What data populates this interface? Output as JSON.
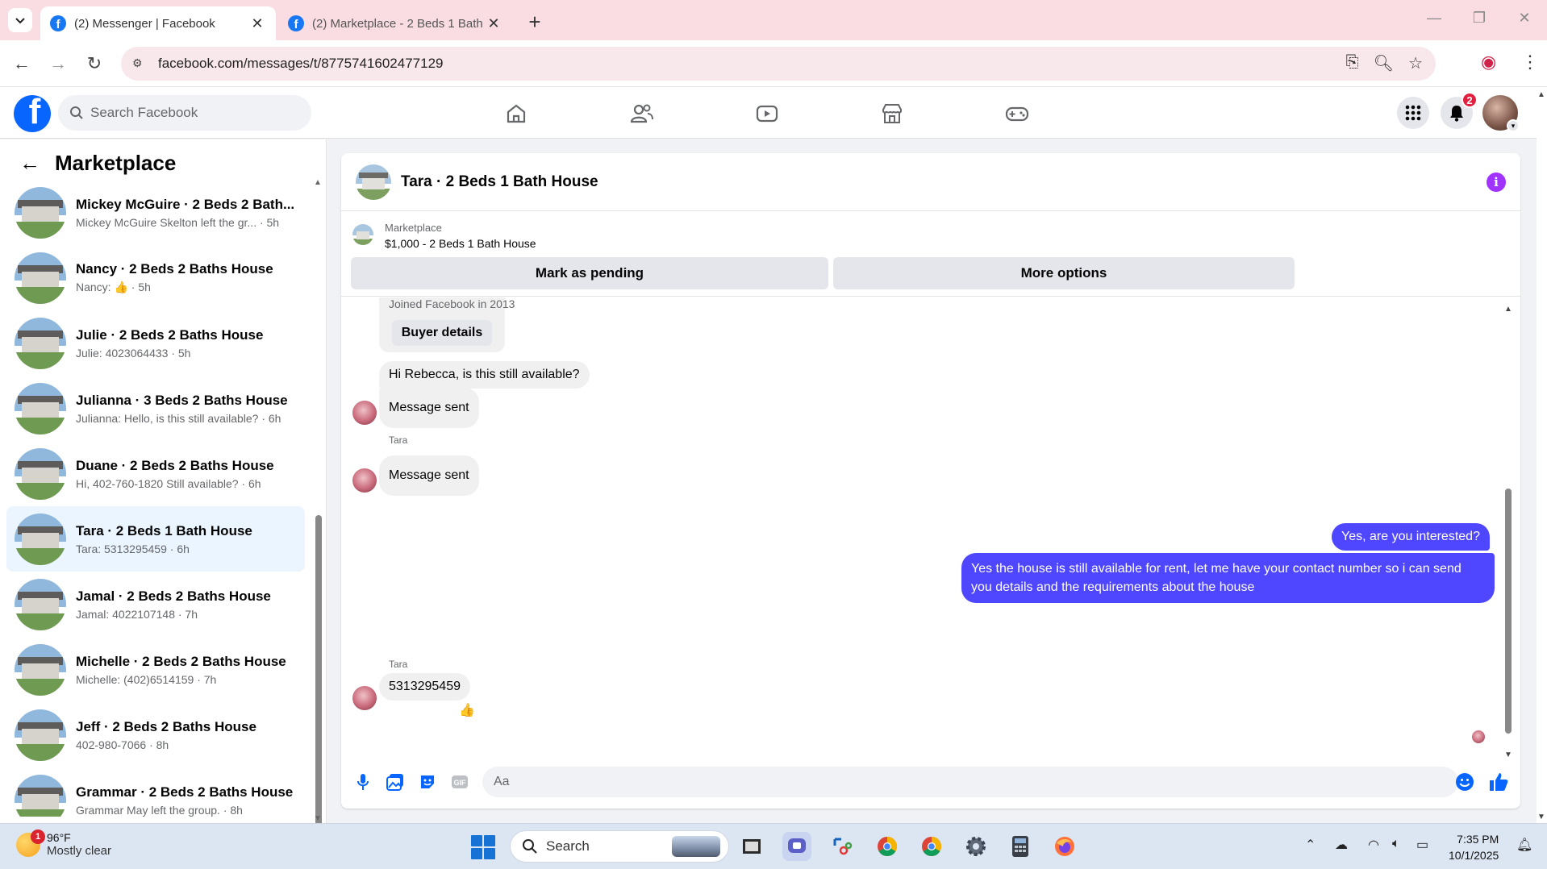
{
  "browser": {
    "tabs": [
      {
        "title": "(2) Messenger | Facebook",
        "active": true
      },
      {
        "title": "(2) Marketplace - 2 Beds 1 Bath",
        "active": false
      }
    ],
    "url": "facebook.com/messages/t/8775741602477129"
  },
  "header": {
    "search_placeholder": "Search Facebook",
    "notifications_count": "2",
    "icons": [
      "home-icon",
      "friends-icon",
      "video-icon",
      "marketplace-icon",
      "gaming-icon",
      "menu-grid-icon",
      "bell-icon"
    ]
  },
  "sidebar": {
    "title": "Marketplace",
    "conversations": [
      {
        "name": "Mickey McGuire · 2 Beds 2 Bath...",
        "preview": "Mickey McGuire Skelton left the gr... · 5h"
      },
      {
        "name": "Nancy · 2 Beds 2 Baths House",
        "preview": "Nancy: 👍 · 5h"
      },
      {
        "name": "Julie · 2 Beds 2 Baths House",
        "preview": "Julie: 4023064433 · 5h"
      },
      {
        "name": "Julianna · 3 Beds 2 Baths House",
        "preview": "Julianna: Hello, is this still available? · 6h"
      },
      {
        "name": "Duane · 2 Beds 2 Baths House",
        "preview": "Hi, 402-760-1820 Still available? · 6h"
      },
      {
        "name": "Tara · 2 Beds 1 Bath House",
        "preview": "Tara: 5313295459 · 6h",
        "selected": true
      },
      {
        "name": "Jamal · 2 Beds 2 Baths House",
        "preview": "Jamal: 4022107148 · 7h"
      },
      {
        "name": "Michelle · 2 Beds 2 Baths House",
        "preview": "Michelle: (402)6514159 · 7h"
      },
      {
        "name": "Jeff · 2 Beds 2 Baths House",
        "preview": "402-980-7066 · 8h"
      },
      {
        "name": "Grammar · 2 Beds 2 Baths House",
        "preview": "Grammar May left the group. · 8h"
      }
    ]
  },
  "chat": {
    "title": "Tara · 2 Beds 1 Bath House",
    "listing": {
      "category": "Marketplace",
      "price_title": "$1,000 - 2 Beds 1 Bath House",
      "mark_pending": "Mark as pending",
      "more_options": "More options"
    },
    "joined": "Joined Facebook in 2013",
    "buyer_details": "Buyer details",
    "messages": {
      "m1": "Hi Rebecca, is this still available?",
      "m2": "Message sent",
      "sender": "Tara",
      "m3": "Message sent",
      "out1": "Yes, are you interested?",
      "out2": "Yes the house is still available for rent, let me have your contact number so i can send you details and the requirements about the house",
      "m4": "5313295459",
      "reaction": "👍"
    },
    "composer_placeholder": "Aa"
  },
  "taskbar": {
    "temp": "96°F",
    "condition": "Mostly clear",
    "weather_badge": "1",
    "search_label": "Search",
    "time": "7:35 PM",
    "date": "10/1/2025"
  },
  "colors": {
    "brand": "#0866ff",
    "outgoing_bubble": "#4f46ff",
    "selected_row": "#ebf5ff",
    "tab_strip": "#f9dde3"
  }
}
